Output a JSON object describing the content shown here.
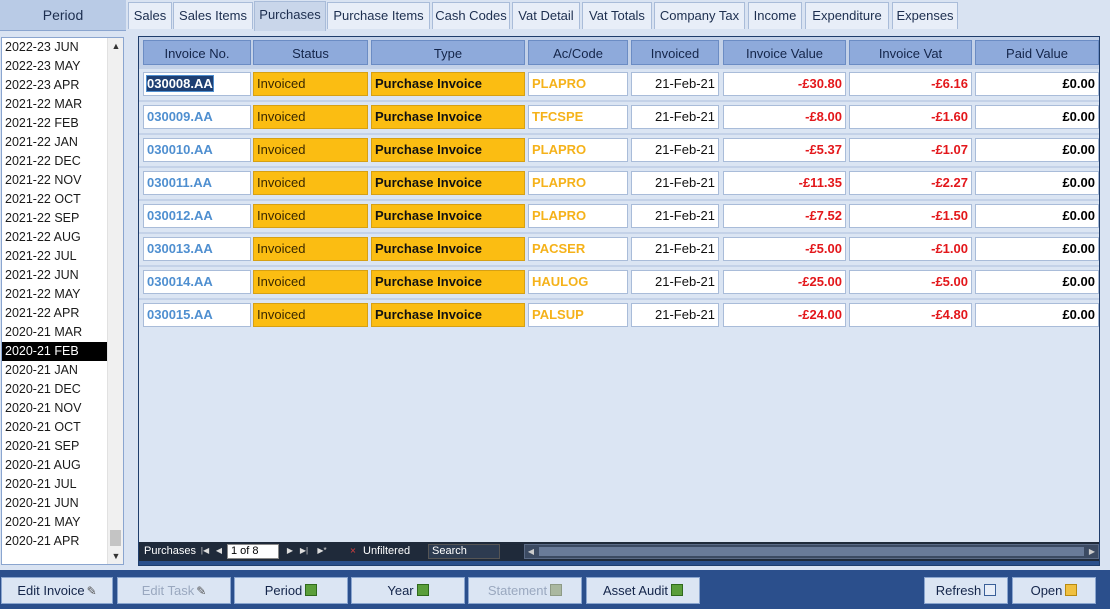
{
  "period_panel": {
    "header": "Period",
    "items": [
      {
        "label": "2022-23 JUN",
        "selected": false
      },
      {
        "label": "2022-23 MAY",
        "selected": false
      },
      {
        "label": "2022-23 APR",
        "selected": false
      },
      {
        "label": "2021-22 MAR",
        "selected": false
      },
      {
        "label": "2021-22 FEB",
        "selected": false
      },
      {
        "label": "2021-22 JAN",
        "selected": false
      },
      {
        "label": "2021-22 DEC",
        "selected": false
      },
      {
        "label": "2021-22 NOV",
        "selected": false
      },
      {
        "label": "2021-22 OCT",
        "selected": false
      },
      {
        "label": "2021-22 SEP",
        "selected": false
      },
      {
        "label": "2021-22 AUG",
        "selected": false
      },
      {
        "label": "2021-22 JUL",
        "selected": false
      },
      {
        "label": "2021-22 JUN",
        "selected": false
      },
      {
        "label": "2021-22 MAY",
        "selected": false
      },
      {
        "label": "2021-22 APR",
        "selected": false
      },
      {
        "label": "2020-21 MAR",
        "selected": false
      },
      {
        "label": "2020-21 FEB",
        "selected": true
      },
      {
        "label": "2020-21 JAN",
        "selected": false
      },
      {
        "label": "2020-21 DEC",
        "selected": false
      },
      {
        "label": "2020-21 NOV",
        "selected": false
      },
      {
        "label": "2020-21 OCT",
        "selected": false
      },
      {
        "label": "2020-21 SEP",
        "selected": false
      },
      {
        "label": "2020-21 AUG",
        "selected": false
      },
      {
        "label": "2020-21 JUL",
        "selected": false
      },
      {
        "label": "2020-21 JUN",
        "selected": false
      },
      {
        "label": "2020-21 MAY",
        "selected": false
      },
      {
        "label": "2020-21 APR",
        "selected": false
      }
    ],
    "scroll_up_glyph": "▲",
    "scroll_down_glyph": "▼"
  },
  "tabs": [
    {
      "label": "Sales",
      "active": false
    },
    {
      "label": "Sales Items",
      "active": false
    },
    {
      "label": "Purchases",
      "active": true
    },
    {
      "label": "Purchase Items",
      "active": false
    },
    {
      "label": "Cash Codes",
      "active": false
    },
    {
      "label": "Vat Detail",
      "active": false
    },
    {
      "label": "Vat Totals",
      "active": false
    },
    {
      "label": "Company Tax",
      "active": false
    },
    {
      "label": "Income",
      "active": false
    },
    {
      "label": "Expenditure",
      "active": false
    },
    {
      "label": "Expenses",
      "active": false
    }
  ],
  "grid": {
    "columns": [
      "Invoice No.",
      "Status",
      "Type",
      "Ac/Code",
      "Invoiced",
      "Invoice Value",
      "Invoice Vat",
      "Paid Value"
    ],
    "rows": [
      {
        "invoice_no": "030008.AA",
        "status": "Invoiced",
        "type": "Purchase Invoice",
        "ac_code": "PLAPRO",
        "invoiced": "21-Feb-21",
        "invoice_value": "-£30.80",
        "invoice_vat": "-£6.16",
        "paid_value": "£0.00",
        "selected": true
      },
      {
        "invoice_no": "030009.AA",
        "status": "Invoiced",
        "type": "Purchase Invoice",
        "ac_code": "TFCSPE",
        "invoiced": "21-Feb-21",
        "invoice_value": "-£8.00",
        "invoice_vat": "-£1.60",
        "paid_value": "£0.00",
        "selected": false
      },
      {
        "invoice_no": "030010.AA",
        "status": "Invoiced",
        "type": "Purchase Invoice",
        "ac_code": "PLAPRO",
        "invoiced": "21-Feb-21",
        "invoice_value": "-£5.37",
        "invoice_vat": "-£1.07",
        "paid_value": "£0.00",
        "selected": false
      },
      {
        "invoice_no": "030011.AA",
        "status": "Invoiced",
        "type": "Purchase Invoice",
        "ac_code": "PLAPRO",
        "invoiced": "21-Feb-21",
        "invoice_value": "-£11.35",
        "invoice_vat": "-£2.27",
        "paid_value": "£0.00",
        "selected": false
      },
      {
        "invoice_no": "030012.AA",
        "status": "Invoiced",
        "type": "Purchase Invoice",
        "ac_code": "PLAPRO",
        "invoiced": "21-Feb-21",
        "invoice_value": "-£7.52",
        "invoice_vat": "-£1.50",
        "paid_value": "£0.00",
        "selected": false
      },
      {
        "invoice_no": "030013.AA",
        "status": "Invoiced",
        "type": "Purchase Invoice",
        "ac_code": "PACSER",
        "invoiced": "21-Feb-21",
        "invoice_value": "-£5.00",
        "invoice_vat": "-£1.00",
        "paid_value": "£0.00",
        "selected": false
      },
      {
        "invoice_no": "030014.AA",
        "status": "Invoiced",
        "type": "Purchase Invoice",
        "ac_code": "HAULOG",
        "invoiced": "21-Feb-21",
        "invoice_value": "-£25.00",
        "invoice_vat": "-£5.00",
        "paid_value": "£0.00",
        "selected": false
      },
      {
        "invoice_no": "030015.AA",
        "status": "Invoiced",
        "type": "Purchase Invoice",
        "ac_code": "PALSUP",
        "invoiced": "21-Feb-21",
        "invoice_value": "-£24.00",
        "invoice_vat": "-£4.80",
        "paid_value": "£0.00",
        "selected": false
      }
    ]
  },
  "nav_bar": {
    "record_label": "Purchases",
    "first_glyph": "|◀",
    "prev_glyph": "◀",
    "record_position": "1 of 8",
    "next_glyph": "▶",
    "last_glyph": "▶|",
    "new_glyph": "▶*",
    "filter_status": "Unfiltered",
    "search_placeholder": "Search",
    "hscroll_left_glyph": "◀",
    "hscroll_right_glyph": "▶"
  },
  "buttons": {
    "edit_invoice": "Edit Invoice",
    "edit_task": "Edit Task",
    "period": "Period",
    "year": "Year",
    "statement": "Statement",
    "asset_audit": "Asset Audit",
    "refresh": "Refresh",
    "open": "Open"
  },
  "icons": {
    "pencil": "✎",
    "filter": "⨯"
  },
  "colors": {
    "accent_blue": "#2b4f8c",
    "status_amber": "#fbbd12",
    "negative_red": "#e3171b",
    "link_blue": "#4f8fd0"
  }
}
